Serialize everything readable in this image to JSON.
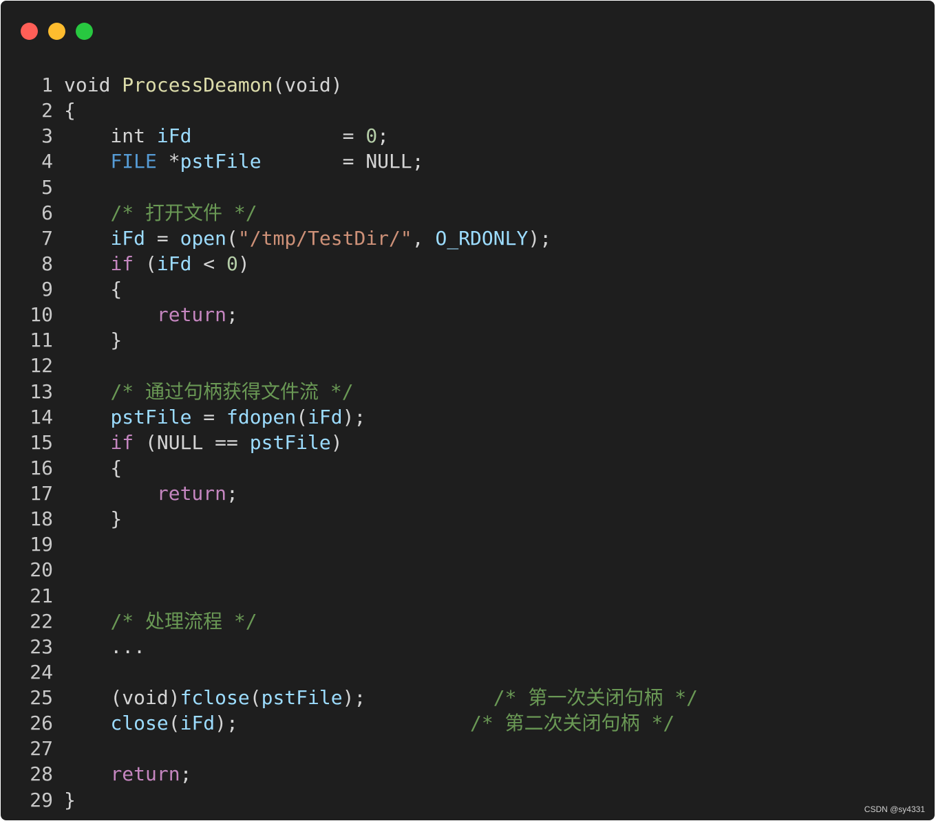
{
  "window": {
    "traffic_lights": [
      {
        "name": "close",
        "color": "#ff5f57"
      },
      {
        "name": "minimize",
        "color": "#febc2e"
      },
      {
        "name": "zoom",
        "color": "#28c840"
      }
    ]
  },
  "code": {
    "lines": [
      {
        "n": "1",
        "tokens": [
          [
            "plain",
            "void "
          ],
          [
            "fn",
            "ProcessDeamon"
          ],
          [
            "plain",
            "(void)"
          ]
        ]
      },
      {
        "n": "2",
        "tokens": [
          [
            "plain",
            "{"
          ]
        ]
      },
      {
        "n": "3",
        "tokens": [
          [
            "plain",
            "    int "
          ],
          [
            "var",
            "iFd"
          ],
          [
            "plain",
            "             = "
          ],
          [
            "num",
            "0"
          ],
          [
            "plain",
            ";"
          ]
        ]
      },
      {
        "n": "4",
        "tokens": [
          [
            "plain",
            "    "
          ],
          [
            "kw",
            "FILE"
          ],
          [
            "plain",
            " *"
          ],
          [
            "var",
            "pstFile"
          ],
          [
            "plain",
            "       = NULL;"
          ]
        ]
      },
      {
        "n": "5",
        "tokens": [
          [
            "plain",
            ""
          ]
        ]
      },
      {
        "n": "6",
        "tokens": [
          [
            "plain",
            "    "
          ],
          [
            "cmt",
            "/* "
          ],
          [
            "cmtcjk",
            "打开文件"
          ],
          [
            "cmt",
            " */"
          ]
        ]
      },
      {
        "n": "7",
        "tokens": [
          [
            "plain",
            "    "
          ],
          [
            "var",
            "iFd"
          ],
          [
            "plain",
            " = "
          ],
          [
            "fn2",
            "open"
          ],
          [
            "plain",
            "("
          ],
          [
            "str",
            "\"/tmp/TestDir/\""
          ],
          [
            "plain",
            ", "
          ],
          [
            "var",
            "O_RDONLY"
          ],
          [
            "plain",
            ");"
          ]
        ]
      },
      {
        "n": "8",
        "tokens": [
          [
            "plain",
            "    "
          ],
          [
            "ctl",
            "if"
          ],
          [
            "plain",
            " ("
          ],
          [
            "var",
            "iFd"
          ],
          [
            "plain",
            " < "
          ],
          [
            "num",
            "0"
          ],
          [
            "plain",
            ")"
          ]
        ]
      },
      {
        "n": "9",
        "tokens": [
          [
            "plain",
            "    {"
          ]
        ]
      },
      {
        "n": "10",
        "tokens": [
          [
            "plain",
            "        "
          ],
          [
            "ctl",
            "return"
          ],
          [
            "plain",
            ";"
          ]
        ]
      },
      {
        "n": "11",
        "tokens": [
          [
            "plain",
            "    }"
          ]
        ]
      },
      {
        "n": "12",
        "tokens": [
          [
            "plain",
            ""
          ]
        ]
      },
      {
        "n": "13",
        "tokens": [
          [
            "plain",
            "    "
          ],
          [
            "cmt",
            "/* "
          ],
          [
            "cmtcjk",
            "通过句柄获得文件流"
          ],
          [
            "cmt",
            " */"
          ]
        ]
      },
      {
        "n": "14",
        "tokens": [
          [
            "plain",
            "    "
          ],
          [
            "var",
            "pstFile"
          ],
          [
            "plain",
            " = "
          ],
          [
            "fn2",
            "fdopen"
          ],
          [
            "plain",
            "("
          ],
          [
            "var",
            "iFd"
          ],
          [
            "plain",
            ");"
          ]
        ]
      },
      {
        "n": "15",
        "tokens": [
          [
            "plain",
            "    "
          ],
          [
            "ctl",
            "if"
          ],
          [
            "plain",
            " (NULL == "
          ],
          [
            "var",
            "pstFile"
          ],
          [
            "plain",
            ")"
          ]
        ]
      },
      {
        "n": "16",
        "tokens": [
          [
            "plain",
            "    {"
          ]
        ]
      },
      {
        "n": "17",
        "tokens": [
          [
            "plain",
            "        "
          ],
          [
            "ctl",
            "return"
          ],
          [
            "plain",
            ";"
          ]
        ]
      },
      {
        "n": "18",
        "tokens": [
          [
            "plain",
            "    }"
          ]
        ]
      },
      {
        "n": "19",
        "tokens": [
          [
            "plain",
            ""
          ]
        ]
      },
      {
        "n": "20",
        "tokens": [
          [
            "plain",
            ""
          ]
        ]
      },
      {
        "n": "21",
        "tokens": [
          [
            "plain",
            ""
          ]
        ]
      },
      {
        "n": "22",
        "tokens": [
          [
            "plain",
            "    "
          ],
          [
            "cmt",
            "/* "
          ],
          [
            "cmtcjk",
            "处理流程"
          ],
          [
            "cmt",
            " */"
          ]
        ]
      },
      {
        "n": "23",
        "tokens": [
          [
            "plain",
            "    ..."
          ]
        ]
      },
      {
        "n": "24",
        "tokens": [
          [
            "plain",
            ""
          ]
        ]
      },
      {
        "n": "25",
        "tokens": [
          [
            "plain",
            "    (void)"
          ],
          [
            "fn2",
            "fclose"
          ],
          [
            "plain",
            "("
          ],
          [
            "var",
            "pstFile"
          ],
          [
            "plain",
            ");           "
          ],
          [
            "cmt",
            "/* "
          ],
          [
            "cmtcjk",
            "第一次关闭句柄"
          ],
          [
            "cmt",
            " */"
          ]
        ]
      },
      {
        "n": "26",
        "tokens": [
          [
            "plain",
            "    "
          ],
          [
            "fn2",
            "close"
          ],
          [
            "plain",
            "("
          ],
          [
            "var",
            "iFd"
          ],
          [
            "plain",
            ");                    "
          ],
          [
            "cmt",
            "/* "
          ],
          [
            "cmtcjk",
            "第二次关闭句柄"
          ],
          [
            "cmt",
            " */"
          ]
        ]
      },
      {
        "n": "27",
        "tokens": [
          [
            "plain",
            ""
          ]
        ]
      },
      {
        "n": "28",
        "tokens": [
          [
            "plain",
            "    "
          ],
          [
            "ctl",
            "return"
          ],
          [
            "plain",
            ";"
          ]
        ]
      },
      {
        "n": "29",
        "tokens": [
          [
            "plain",
            "}"
          ]
        ]
      }
    ]
  },
  "watermark": "CSDN @sy4331"
}
